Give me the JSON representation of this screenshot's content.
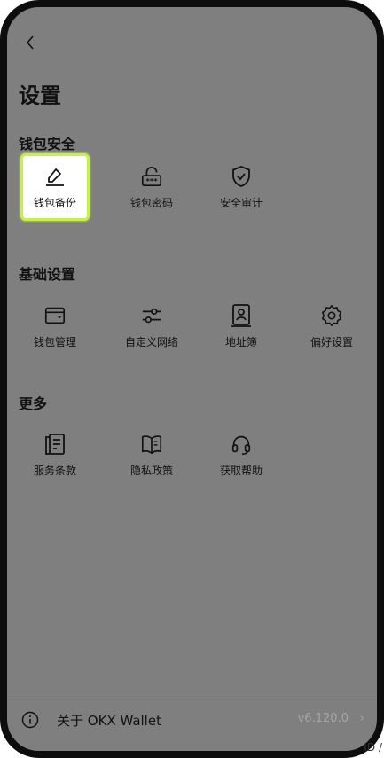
{
  "page": {
    "title": "设置"
  },
  "sections": [
    {
      "title": "钱包安全",
      "items": [
        {
          "label": "钱包备份",
          "icon": "edit-pen-icon",
          "selected": true
        },
        {
          "label": "钱包密码",
          "icon": "password-lock-icon"
        },
        {
          "label": "安全审计",
          "icon": "shield-check-icon"
        }
      ]
    },
    {
      "title": "基础设置",
      "items": [
        {
          "label": "钱包管理",
          "icon": "wallet-icon"
        },
        {
          "label": "自定义网络",
          "icon": "sliders-icon"
        },
        {
          "label": "地址簿",
          "icon": "address-book-icon"
        },
        {
          "label": "偏好设置",
          "icon": "gear-icon"
        }
      ]
    },
    {
      "title": "更多",
      "items": [
        {
          "label": "服务条款",
          "icon": "terms-document-icon"
        },
        {
          "label": "隐私政策",
          "icon": "privacy-book-icon"
        },
        {
          "label": "获取帮助",
          "icon": "headset-icon"
        }
      ]
    }
  ],
  "footer": {
    "about_label": "关于 OKX Wallet",
    "version": "v6.120.0"
  },
  "outside_text": "ID /",
  "colors": {
    "overlay": "#7f7f7f",
    "highlight_border": "#c4f14a",
    "frame": "#0d0d0d"
  }
}
